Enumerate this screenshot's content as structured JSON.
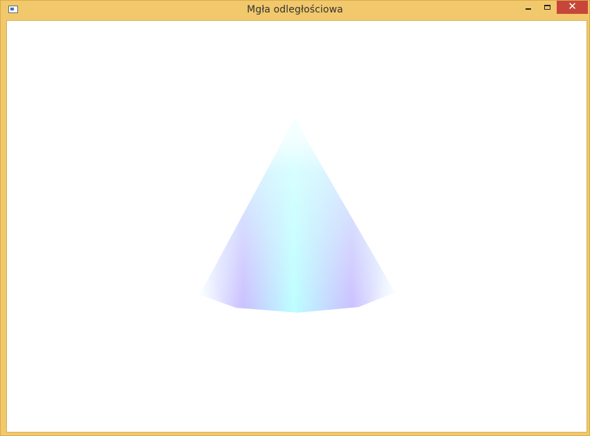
{
  "window": {
    "title": "Mgła odległościowa",
    "controls": {
      "minimize_icon": "minimize-icon",
      "maximize_icon": "maximize-icon",
      "close_icon": "close-icon",
      "close_glyph": "✕"
    },
    "frame_color": "#f1c86c",
    "close_button_color": "#c7463a"
  },
  "scene": {
    "object": "cone",
    "background_color": "#ffffff",
    "colors": {
      "highlight": "#b8ffff",
      "shade": "#c2b8ff",
      "edge_fog": "#f2ffff"
    }
  }
}
